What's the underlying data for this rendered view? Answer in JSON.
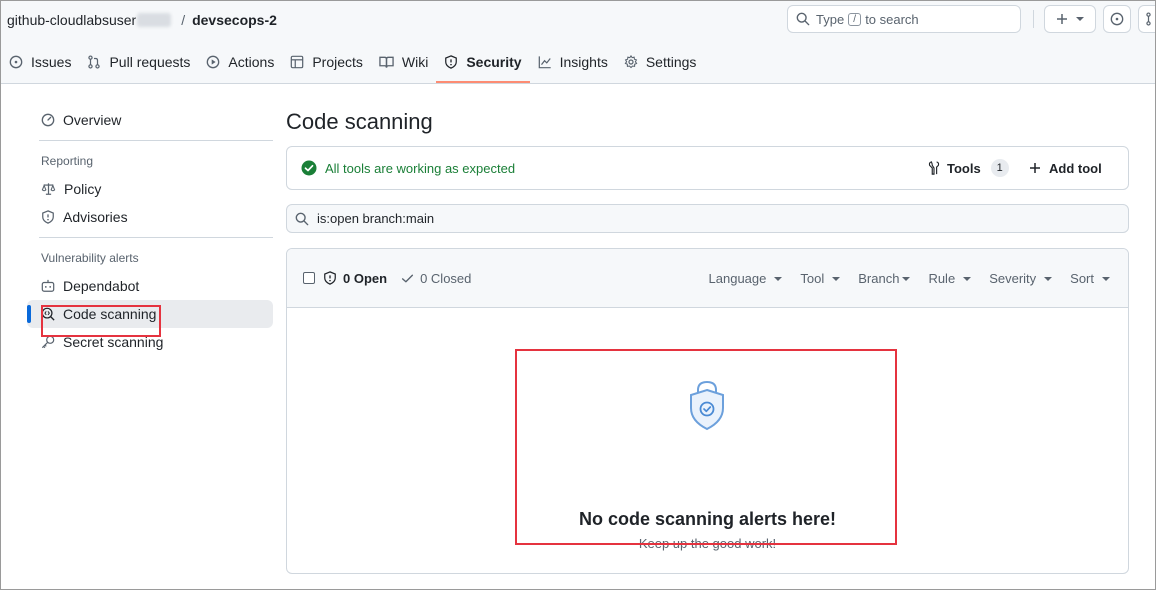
{
  "header": {
    "owner": "github-cloudlabsuser",
    "separator": "/",
    "repo": "devsecops-2",
    "search_prefix": "Type",
    "search_key": "/",
    "search_suffix": "to search"
  },
  "tabs": [
    {
      "label": "Issues",
      "icon": "issue-icon"
    },
    {
      "label": "Pull requests",
      "icon": "pull-request-icon"
    },
    {
      "label": "Actions",
      "icon": "play-icon"
    },
    {
      "label": "Projects",
      "icon": "table-icon"
    },
    {
      "label": "Wiki",
      "icon": "book-icon"
    },
    {
      "label": "Security",
      "icon": "shield-icon",
      "selected": true
    },
    {
      "label": "Insights",
      "icon": "graph-icon"
    },
    {
      "label": "Settings",
      "icon": "gear-icon"
    }
  ],
  "sidebar": {
    "overview": "Overview",
    "reporting_heading": "Reporting",
    "policy": "Policy",
    "advisories": "Advisories",
    "vuln_heading": "Vulnerability alerts",
    "dependabot": "Dependabot",
    "code_scanning": "Code scanning",
    "secret_scanning": "Secret scanning"
  },
  "main": {
    "title": "Code scanning",
    "status_text": "All tools are working as expected",
    "tools_label": "Tools",
    "tools_count": "1",
    "add_tool_label": "Add tool",
    "filter_value": "is:open branch:main",
    "open_label": "0 Open",
    "closed_label": "0 Closed",
    "filters": [
      "Language",
      "Tool",
      "Branch",
      "Rule",
      "Severity",
      "Sort"
    ],
    "blank_title": "No code scanning alerts here!",
    "blank_subtitle": "Keep up the good work!"
  },
  "colors": {
    "accent": "#0969da",
    "success": "#1a7f37",
    "tab_underline": "#fd8c73",
    "highlight_box": "#e5333f"
  }
}
